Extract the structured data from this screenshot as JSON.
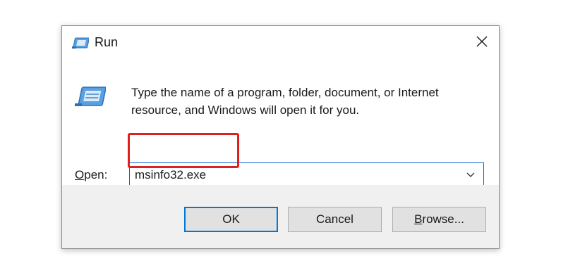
{
  "window": {
    "title": "Run",
    "icon": "run-icon",
    "close_icon": "close-icon"
  },
  "content": {
    "icon": "run-program-icon",
    "description": "Type the name of a program, folder, document, or Internet resource, and Windows will open it for you."
  },
  "open_field": {
    "label_prefix": "",
    "label_accel": "O",
    "label_rest": "pen:",
    "value": "msinfo32.exe",
    "dropdown_icon": "chevron-down-icon"
  },
  "buttons": {
    "ok": "OK",
    "cancel": "Cancel",
    "browse_accel": "B",
    "browse_rest": "rowse..."
  },
  "colors": {
    "accent": "#0078d7",
    "highlight": "#e02020",
    "footer_bg": "#f0f0f0"
  }
}
